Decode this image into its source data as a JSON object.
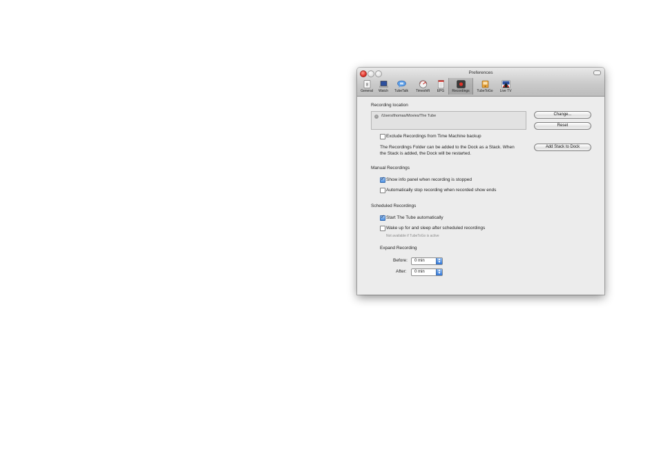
{
  "window": {
    "title": "Preferences"
  },
  "toolbar": {
    "items": [
      {
        "label": "General",
        "icon": "general-icon"
      },
      {
        "label": "Watch",
        "icon": "laptop-icon"
      },
      {
        "label": "TubeTalk",
        "icon": "chat-icon"
      },
      {
        "label": "Timeshift",
        "icon": "gauge-icon"
      },
      {
        "label": "EPG",
        "icon": "list-icon"
      },
      {
        "label": "Recordings",
        "icon": "record-icon",
        "active": true
      },
      {
        "label": "TubeToGo",
        "icon": "tubetogo-icon"
      },
      {
        "label": "Live TV",
        "icon": "live-tv-icon"
      }
    ]
  },
  "recording_location": {
    "heading": "Recording location",
    "path": "/Users/thomas/Movies/The Tube",
    "change_label": "Change...",
    "reset_label": "Reset",
    "exclude_label": "Exclude Recordings from Time Machine backup",
    "exclude_checked": false,
    "stack_info_line1": "The Recordings Folder can be added to the Dock as a Stack. When",
    "stack_info_line2": "the Stack is added, the Dock will be restarted.",
    "add_stack_label": "Add Stack to Dock"
  },
  "manual": {
    "heading": "Manual Recordings",
    "show_info_label": "Show info panel when recording is stopped",
    "show_info_checked": true,
    "auto_stop_label": "Automatically stop recording when recorded show ends",
    "auto_stop_checked": false
  },
  "scheduled": {
    "heading": "Scheduled Recordings",
    "start_label": "Start The Tube automatically",
    "start_checked": true,
    "wake_label": "Wake up for and sleep after scheduled recordings",
    "wake_checked": false,
    "wake_note": "Not available if TubeToGo is active"
  },
  "expand": {
    "heading": "Expand Recording",
    "before_label": "Before:",
    "before_value": "0 min",
    "after_label": "After:",
    "after_value": "0 min"
  },
  "colors": {
    "accent": "#4b8fe0",
    "window_bg": "#ececec",
    "close_red": "#e0332a"
  }
}
